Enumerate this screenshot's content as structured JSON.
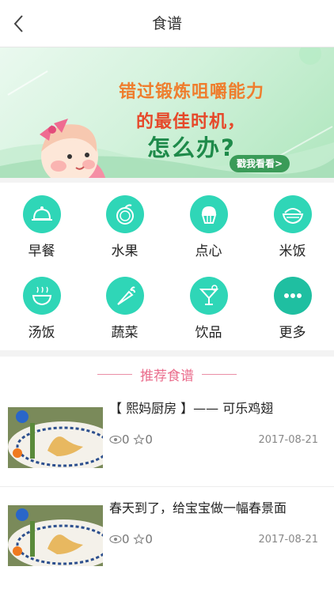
{
  "header": {
    "title": "食谱",
    "back_icon": "chevron-left-icon"
  },
  "banner": {
    "line1": "错过锻炼咀嚼能力",
    "line2": "的最佳时机，",
    "line3": "怎么办?",
    "button_label": "戳我看看>",
    "colors": {
      "orange": "#ef7d2d",
      "red": "#e6482a",
      "green": "#1e8a4a"
    }
  },
  "categories": [
    {
      "label": "早餐",
      "icon": "cloche-icon"
    },
    {
      "label": "水果",
      "icon": "orange-fruit-icon"
    },
    {
      "label": "点心",
      "icon": "cupcake-icon"
    },
    {
      "label": "米饭",
      "icon": "rice-bowl-icon"
    },
    {
      "label": "汤饭",
      "icon": "soup-bowl-icon"
    },
    {
      "label": "蔬菜",
      "icon": "carrot-icon"
    },
    {
      "label": "饮品",
      "icon": "cocktail-icon"
    },
    {
      "label": "更多",
      "icon": "more-dots-icon"
    }
  ],
  "recommend": {
    "title": "推荐食谱",
    "items": [
      {
        "title": "【 熙妈厨房 】—— 可乐鸡翅",
        "views": "0",
        "favorites": "0",
        "date": "2017-08-21"
      },
      {
        "title": "春天到了，给宝宝做一幅春景面",
        "views": "0",
        "favorites": "0",
        "date": "2017-08-21"
      }
    ]
  },
  "theme": {
    "accent": "#2fd6b7",
    "accent_dark": "#1fbfa1",
    "pink": "#ea6d8c"
  }
}
